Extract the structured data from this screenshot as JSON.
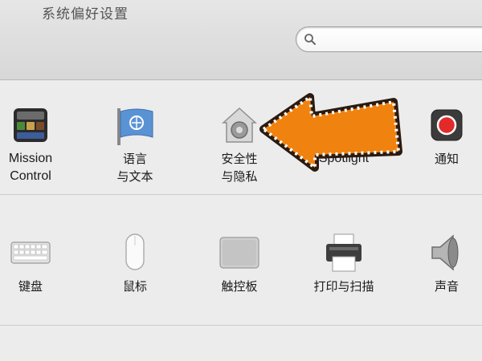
{
  "window": {
    "title": "系统偏好设置"
  },
  "search": {
    "placeholder": ""
  },
  "row1": [
    {
      "label": "Mission\nControl",
      "icon": "mission-control-icon"
    },
    {
      "label": "语言\n与文本",
      "icon": "language-flag-icon"
    },
    {
      "label": "安全性\n与隐私",
      "icon": "security-house-icon"
    },
    {
      "label": "Spotlight",
      "icon": "spotlight-icon"
    },
    {
      "label": "通知",
      "icon": "notification-icon"
    }
  ],
  "row2": [
    {
      "label": "键盘",
      "icon": "keyboard-icon"
    },
    {
      "label": "鼠标",
      "icon": "mouse-icon"
    },
    {
      "label": "触控板",
      "icon": "trackpad-icon"
    },
    {
      "label": "打印与扫描",
      "icon": "printer-icon"
    },
    {
      "label": "声音",
      "icon": "speaker-icon"
    }
  ],
  "annotation": {
    "arrow_color": "#f0820f"
  }
}
